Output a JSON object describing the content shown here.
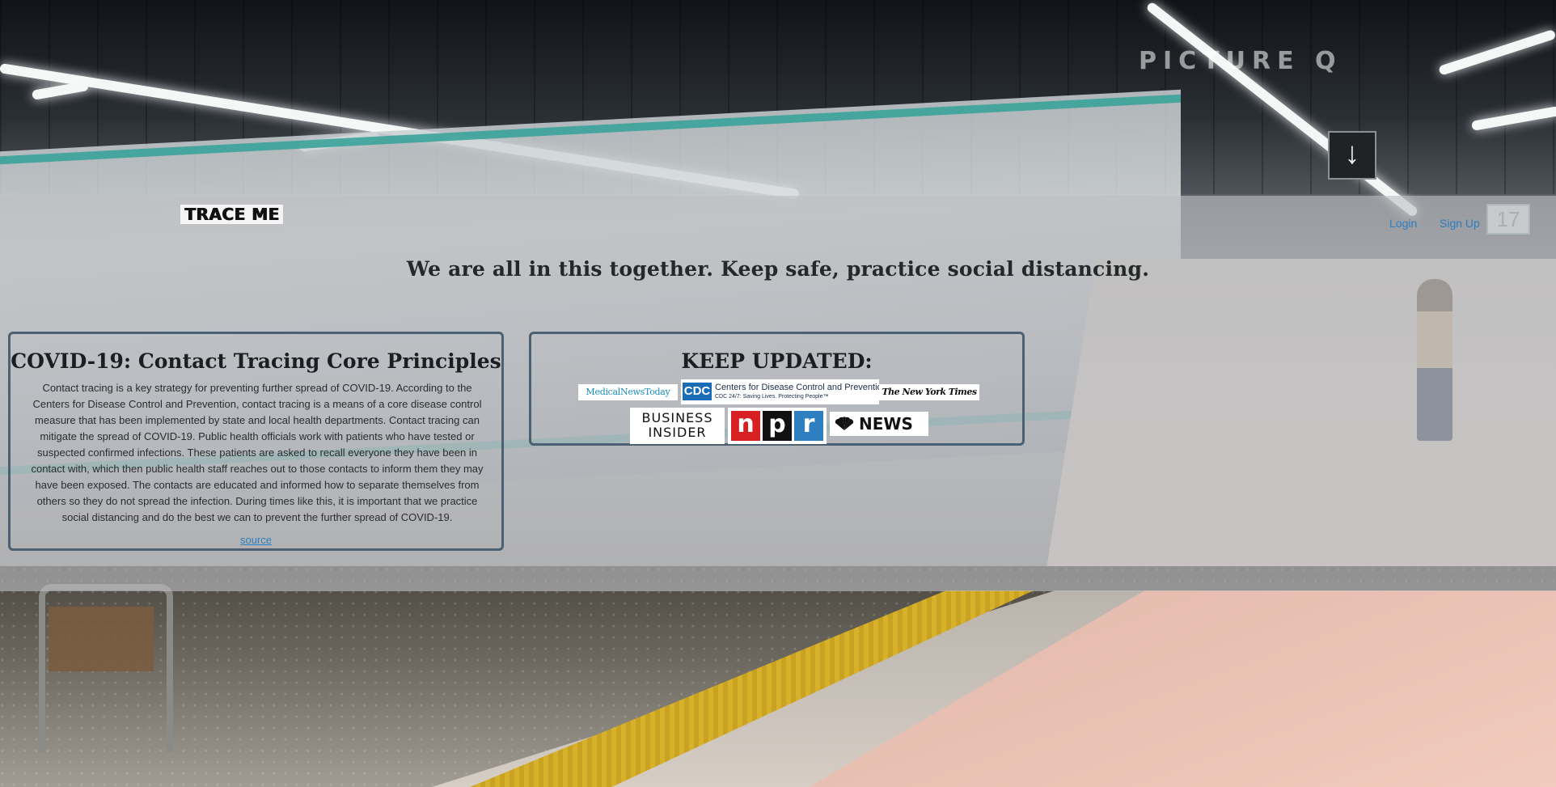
{
  "background": {
    "watermark": "PICTURE Q",
    "platform_sign": "↓",
    "platform_number": "17"
  },
  "header": {
    "brand": "TRACE ME",
    "nav": {
      "login": "Login",
      "signup": "Sign Up"
    }
  },
  "tagline": "We are all in this together. Keep safe, practice social distancing.",
  "covid_card": {
    "title": "COVID-19: Contact Tracing Core Principles",
    "body": "Contact tracing is a key strategy for preventing further spread of COVID-19. According to the Centers for Disease Control and Prevention, contact tracing is a means of a core disease control measure that has been implemented by state and local health departments. Contact tracing can mitigate the spread of COVID-19. Public health officials work with patients who have tested or suspected confirmed infections. These patients are asked to recall everyone they have been in contact with, which then public health staff reaches out to those contacts to inform them they may have been exposed. The contacts are educated and informed how to separate themselves from others so they do not spread the infection. During times like this, it is important that we practice social distancing and do the best we can to prevent the further spread of COVID-19.",
    "source_link": "source"
  },
  "updates_card": {
    "title": "KEEP UPDATED:",
    "logos": {
      "medical_news_today": "MedicalNewsToday",
      "cdc_abbr": "CDC",
      "cdc_name": "Centers for Disease Control and Prevention",
      "cdc_tagline": "CDC 24/7: Saving Lives. Protecting People™",
      "nyt": "The New York Times",
      "business_insider_line1": "BUSINESS",
      "business_insider_line2": "INSIDER",
      "npr_n": "n",
      "npr_p": "p",
      "npr_r": "r",
      "nbc": "NEWS"
    }
  },
  "colors": {
    "link": "#2b7fbc",
    "card_border": "#4b6173",
    "cdc_blue": "#1a6db5",
    "npr_red": "#d62021",
    "npr_black": "#111111",
    "npr_blue": "#2d7fc1"
  }
}
